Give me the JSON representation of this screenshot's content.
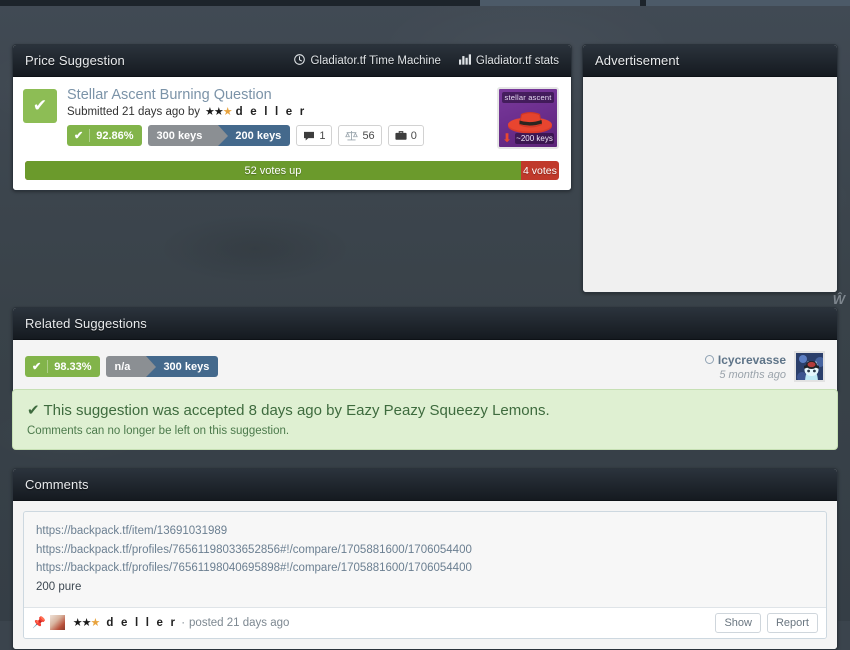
{
  "suggestion_panel": {
    "title": "Price Suggestion",
    "links": [
      {
        "label": "Gladiator.tf Time Machine",
        "icon": "clock-icon"
      },
      {
        "label": "Gladiator.tf stats",
        "icon": "bar-chart-icon"
      }
    ],
    "item": {
      "name": "Stellar Ascent Burning Question",
      "submitted_text": "Submitted 21 days ago by",
      "author": "d e l l e r",
      "author_stars": "★★★",
      "image_label": "stellar ascent",
      "image_price": "~200 keys",
      "image_trend": "down"
    },
    "badges": {
      "percent": "92.86%",
      "check": "✔",
      "old_price": "300 keys",
      "new_price": "200 keys",
      "comments_count": "1",
      "votes_count": "56",
      "backpacks_count": "0"
    },
    "votes": {
      "up_label": "52 votes up",
      "down_label": "4 votes",
      "up_percent": 92.86
    }
  },
  "advertisement": {
    "title": "Advertisement"
  },
  "related": {
    "title": "Related Suggestions",
    "entry": {
      "percent": "98.33%",
      "check": "✔",
      "old_price": "n/a",
      "new_price": "300 keys",
      "user": "Icycrevasse",
      "time": "5 months ago"
    }
  },
  "accepted": {
    "message": "This suggestion was accepted 8 days ago by Eazy Peazy Squeezy Lemons.",
    "check": "✔",
    "sub": "Comments can no longer be left on this suggestion."
  },
  "comments": {
    "title": "Comments",
    "entry": {
      "lines": [
        {
          "text": "https://backpack.tf/item/13691031989",
          "type": "link"
        },
        {
          "text": "https://backpack.tf/profiles/76561198033652856#!/compare/1705881600/1706054400",
          "type": "link"
        },
        {
          "text": "https://backpack.tf/profiles/76561198040695898#!/compare/1705881600/1706054400",
          "type": "link"
        },
        {
          "text": "200 pure",
          "type": "plain"
        }
      ],
      "author": "d e l l e r",
      "author_stars": "★★★",
      "separator": "·",
      "posted": "posted 21 days ago",
      "show_label": "Show",
      "report_label": "Report"
    }
  },
  "watermark": "Ŵ",
  "colors": {
    "background": "#3b444d",
    "panel_header": "#2b333c",
    "accent_green": "#82b44a",
    "vote_up": "#6b9a2c",
    "vote_down": "#c0392b",
    "price_old": "#8b8f93",
    "price_new": "#44698c",
    "accepted_bg": "#dff0d2",
    "link_blue": "#6b7f91"
  }
}
